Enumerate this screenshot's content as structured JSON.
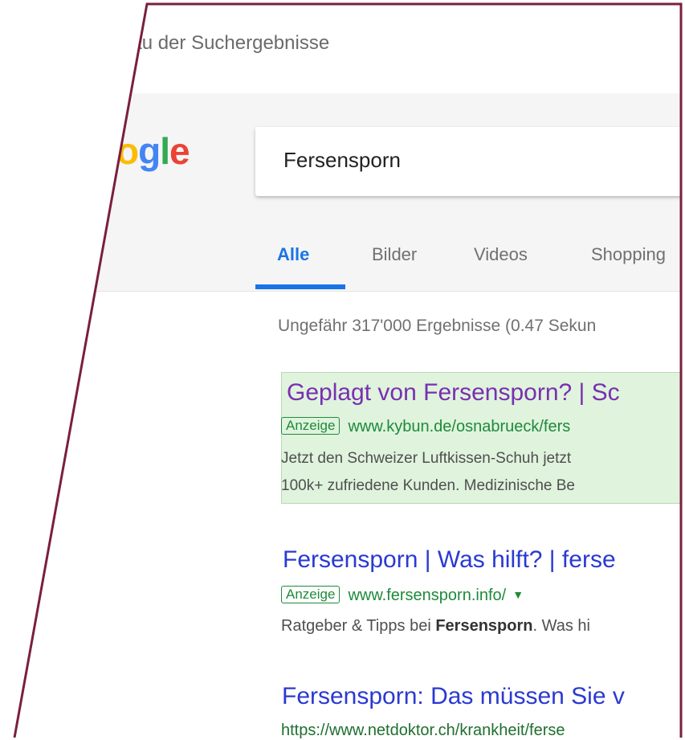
{
  "page": {
    "top_title": "hau der Suchergebnisse"
  },
  "header": {
    "logo": {
      "o": "o",
      "g": "g",
      "l": "l",
      "e": "e"
    },
    "search_value": "Fersensporn",
    "tabs": [
      "Alle",
      "Bilder",
      "Videos",
      "Shopping"
    ],
    "active_tab": "Alle"
  },
  "results": {
    "stats": "Ungefähr 317'000 Ergebnisse (0.47 Sekun",
    "ad1": {
      "title": "Geplagt von Fersensporn? | Sc",
      "badge": "Anzeige",
      "url": "www.kybun.de/osnabrueck/fers",
      "snippet1": "Jetzt den Schweizer Luftkissen-Schuh jetzt",
      "snippet2": "100k+ zufriedene Kunden. Medizinische Be"
    },
    "ad2": {
      "title": "Fersensporn | Was hilft? | ferse",
      "badge": "Anzeige",
      "url": "www.fersensporn.info/",
      "snippet_prefix": "Ratgeber & Tipps bei ",
      "snippet_bold": "Fersensporn",
      "snippet_suffix": ". Was hi"
    },
    "organic1": {
      "title": "Fersensporn: Das müssen Sie v",
      "url": "https://www.netdoktor.ch/krankheit/ferse"
    }
  },
  "colors": {
    "accent": "#1a73e8",
    "frame": "#7a1f3d",
    "ad_bg": "#dff3dd",
    "link": "#2a3ad1",
    "visited": "#7a2fb1",
    "url_green": "#1f8a3a"
  }
}
